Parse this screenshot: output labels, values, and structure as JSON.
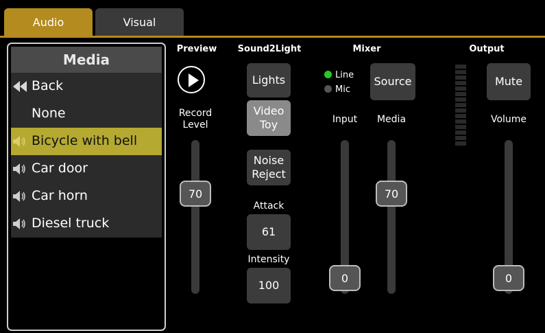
{
  "tabs": {
    "audio": "Audio",
    "visual": "Visual"
  },
  "media": {
    "title": "Media",
    "items": [
      {
        "label": "Back",
        "icon": "back-icon"
      },
      {
        "label": "None",
        "icon": ""
      },
      {
        "label": "Bicycle with bell",
        "icon": "speaker-icon",
        "selected": true
      },
      {
        "label": "Car door",
        "icon": "speaker-icon"
      },
      {
        "label": "Car horn",
        "icon": "speaker-icon"
      },
      {
        "label": "Diesel truck",
        "icon": "speaker-icon"
      }
    ]
  },
  "sections": {
    "preview": "Preview",
    "sound2light": "Sound2Light",
    "mixer": "Mixer",
    "output": "Output"
  },
  "preview": {
    "record_level_label": "Record Level",
    "record_level_value": "70"
  },
  "sound2light": {
    "lights": "Lights",
    "video_toy": "Video Toy",
    "noise_reject": "Noise Reject",
    "attack_label": "Attack",
    "attack_value": "61",
    "intensity_label": "Intensity",
    "intensity_value": "100"
  },
  "mixer": {
    "line": "Line",
    "mic": "Mic",
    "source": "Source",
    "input_label": "Input",
    "input_value": "0",
    "media_label": "Media",
    "media_value": "70"
  },
  "output": {
    "mute": "Mute",
    "volume_label": "Volume",
    "volume_value": "0"
  },
  "colors": {
    "accent": "#b38b1e",
    "selected": "#b5a931",
    "line_indicator": "#22cc22"
  }
}
